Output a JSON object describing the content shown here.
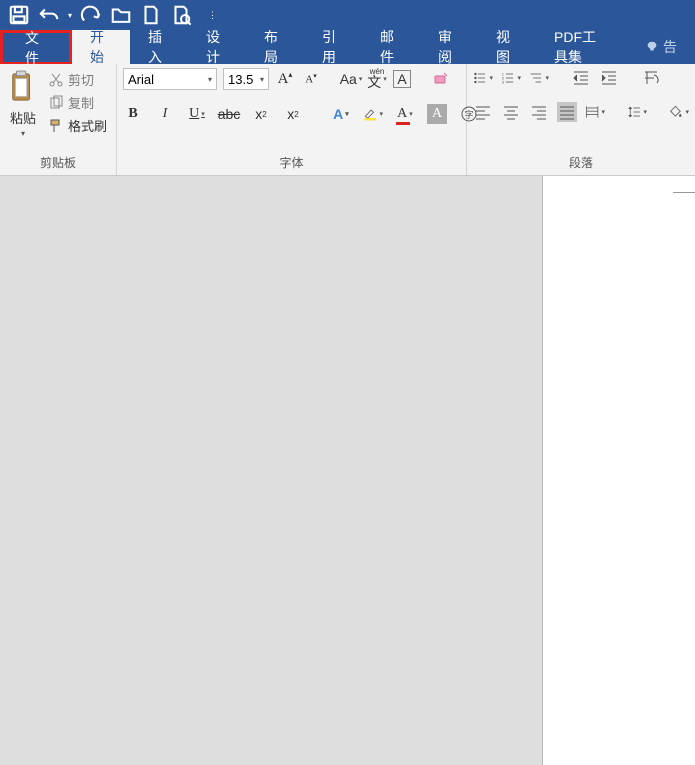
{
  "tabs": {
    "file": "文件",
    "home": "开始",
    "insert": "插入",
    "design": "设计",
    "layout": "布局",
    "references": "引用",
    "mail": "邮件",
    "review": "审阅",
    "view": "视图",
    "pdf": "PDF工具集",
    "tell": "告"
  },
  "ribbon": {
    "clipboard": {
      "paste": "粘贴",
      "cut": "剪切",
      "copy": "复制",
      "format_painter": "格式刷",
      "label": "剪贴板"
    },
    "font": {
      "name": "Arial",
      "size": "13.5",
      "label": "字体"
    },
    "paragraph": {
      "label": "段落"
    }
  }
}
